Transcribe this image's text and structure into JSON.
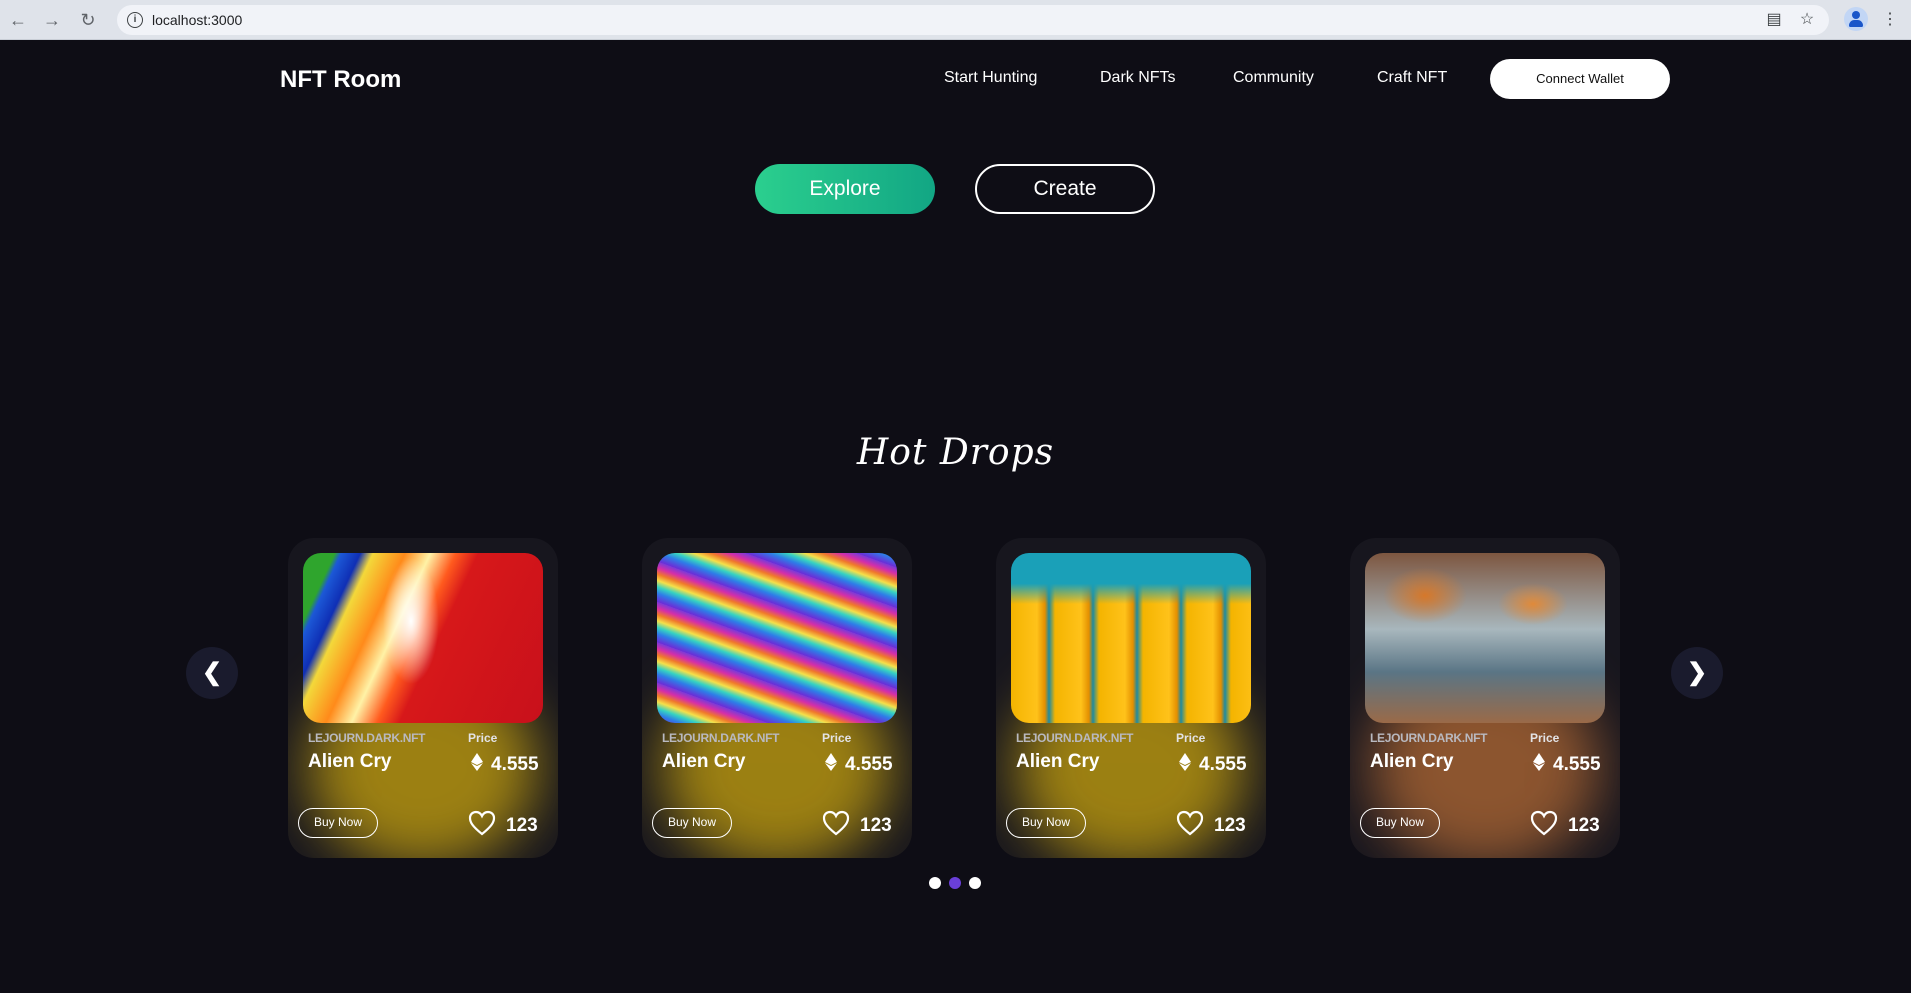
{
  "browser": {
    "url": "localhost:3000"
  },
  "navbar": {
    "brand": "NFT Room",
    "links": [
      "Start Hunting",
      "Dark NFTs",
      "Community",
      "Craft NFT"
    ],
    "connect_label": "Connect Wallet"
  },
  "hero": {
    "explore_label": "Explore",
    "create_label": "Create"
  },
  "hot_drops": {
    "title": "Hot Drops",
    "prev_glyph": "❮",
    "next_glyph": "❯",
    "cards": [
      {
        "creator": "LEJOURN.DARK.NFT",
        "price_label": "Price",
        "name": "Alien Cry",
        "price": "4.555",
        "buy_label": "Buy Now",
        "likes": "123",
        "glow": "#c9a40f"
      },
      {
        "creator": "LEJOURN.DARK.NFT",
        "price_label": "Price",
        "name": "Alien Cry",
        "price": "4.555",
        "buy_label": "Buy Now",
        "likes": "123",
        "glow": "#c9a40f"
      },
      {
        "creator": "LEJOURN.DARK.NFT",
        "price_label": "Price",
        "name": "Alien Cry",
        "price": "4.555",
        "buy_label": "Buy Now",
        "likes": "123",
        "glow": "#c9a40f"
      },
      {
        "creator": "LEJOURN.DARK.NFT",
        "price_label": "Price",
        "name": "Alien Cry",
        "price": "4.555",
        "buy_label": "Buy Now",
        "likes": "123",
        "glow": "#b36a35"
      }
    ],
    "pagination": {
      "count": 3,
      "active": 1,
      "active_color": "#6a3fd8",
      "inactive_color": "#ffffff"
    }
  },
  "colors": {
    "background": "#0e0d15",
    "accent_green": "#2bcf8e"
  }
}
